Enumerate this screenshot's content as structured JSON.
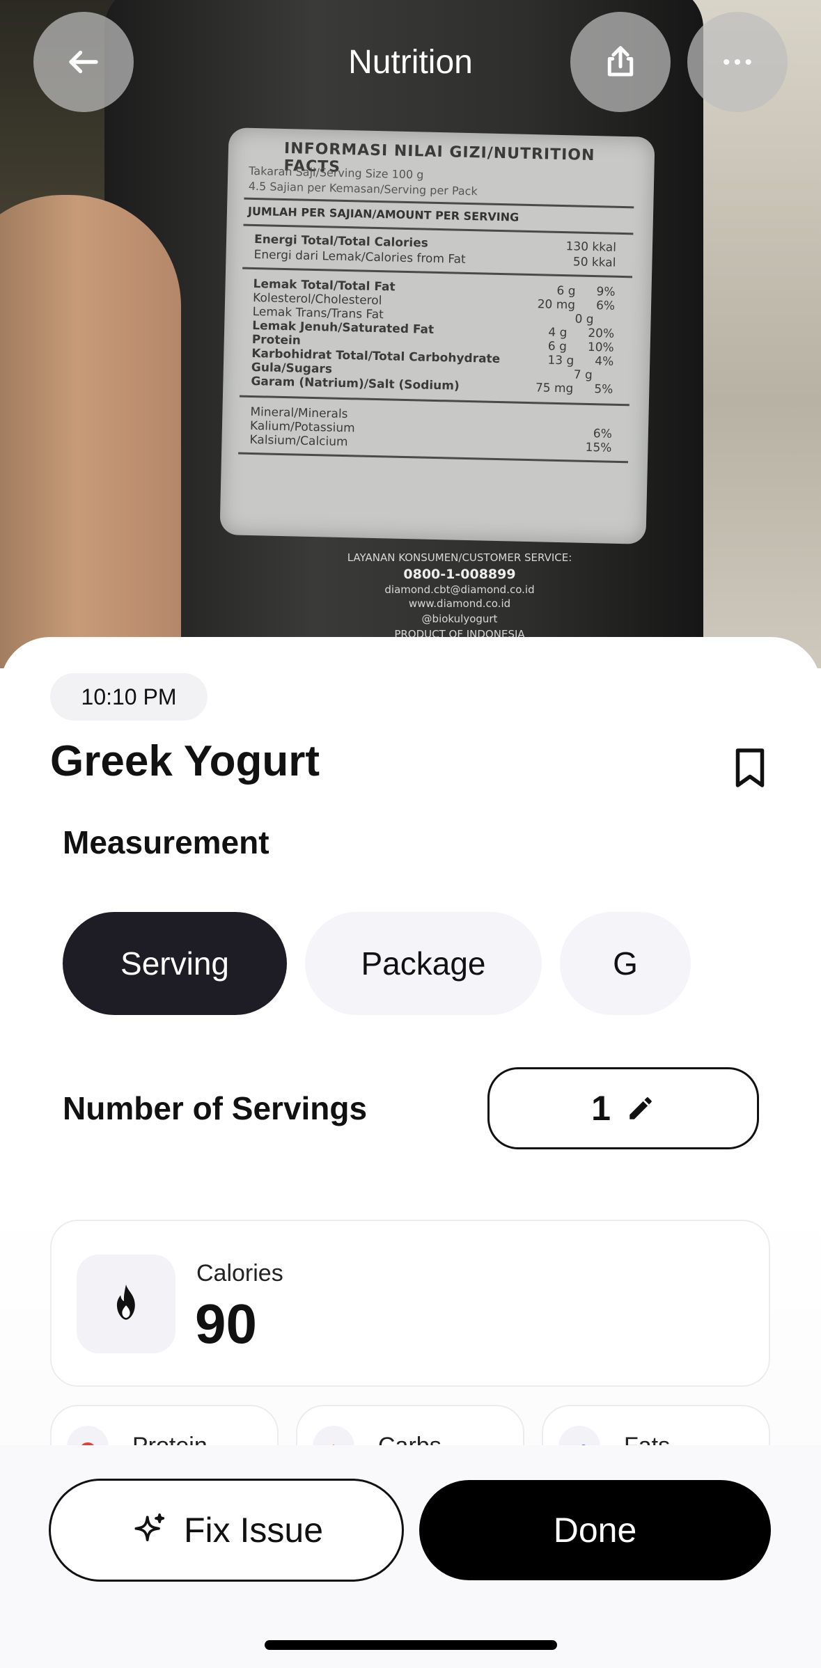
{
  "header": {
    "title": "Nutrition",
    "back_icon": "arrow-left-icon",
    "share_icon": "share-icon",
    "more_icon": "more-horizontal-icon"
  },
  "photo_label": {
    "title": "INFORMASI NILAI GIZI/NUTRITION FACTS",
    "serving_size": "Takaran Saji/Serving Size 100 g",
    "servings_per_pack": "4.5 Sajian per Kemasan/Serving per Pack",
    "amount_header": "JUMLAH PER SAJIAN/AMOUNT PER SERVING",
    "rows": [
      {
        "name": "Energi Total/Total Calories",
        "amount": "130 kkal",
        "dv": ""
      },
      {
        "name": "Energi dari Lemak/Calories from Fat",
        "amount": "50 kkal",
        "dv": ""
      },
      {
        "name": "Lemak Total/Total Fat",
        "amount": "6 g",
        "dv": "9%"
      },
      {
        "name": "Kolesterol/Cholesterol",
        "amount": "20 mg",
        "dv": "6%"
      },
      {
        "name": "Lemak Trans/Trans Fat",
        "amount": "0 g",
        "dv": ""
      },
      {
        "name": "Lemak Jenuh/Saturated Fat",
        "amount": "4 g",
        "dv": "20%"
      },
      {
        "name": "Protein",
        "amount": "6 g",
        "dv": "10%"
      },
      {
        "name": "Karbohidrat Total/Total Carbohydrate",
        "amount": "13 g",
        "dv": "4%"
      },
      {
        "name": "Gula/Sugars",
        "amount": "7 g",
        "dv": ""
      },
      {
        "name": "Garam (Natrium)/Salt (Sodium)",
        "amount": "75 mg",
        "dv": "5%"
      },
      {
        "name": "Mineral/Minerals",
        "amount": "",
        "dv": ""
      },
      {
        "name": "Kalium/Potassium",
        "amount": "",
        "dv": "6%"
      },
      {
        "name": "Kalsium/Calcium",
        "amount": "",
        "dv": "15%"
      }
    ],
    "customer_service": "LAYANAN KONSUMEN/CUSTOMER SERVICE:",
    "phone": "0800-1-008899",
    "email": "diamond.cbt@diamond.co.id",
    "website": "www.diamond.co.id",
    "social": "@biokulyogurt",
    "origin": "PRODUCT OF INDONESIA"
  },
  "entry": {
    "time": "10:10 PM",
    "food_name": "Greek Yogurt",
    "bookmark_icon": "bookmark-icon"
  },
  "measurement": {
    "label": "Measurement",
    "options": [
      "Serving",
      "Package",
      "G"
    ],
    "selected": "Serving"
  },
  "servings": {
    "label": "Number of Servings",
    "value": "1",
    "edit_icon": "pencil-icon"
  },
  "calories": {
    "label": "Calories",
    "value": "90",
    "icon": "flame-icon"
  },
  "macros": [
    {
      "label": "Protein",
      "color": "#e0403a"
    },
    {
      "label": "Carbs",
      "color": "#e8833a"
    },
    {
      "label": "Fats",
      "color": "#3a6fe0"
    }
  ],
  "actions": {
    "fix_issue": "Fix Issue",
    "fix_icon": "sparkle-icon",
    "done": "Done"
  },
  "colors": {
    "accent_dark": "#1e1c25",
    "button_black": "#000000",
    "chip_bg": "#f5f5f9"
  }
}
